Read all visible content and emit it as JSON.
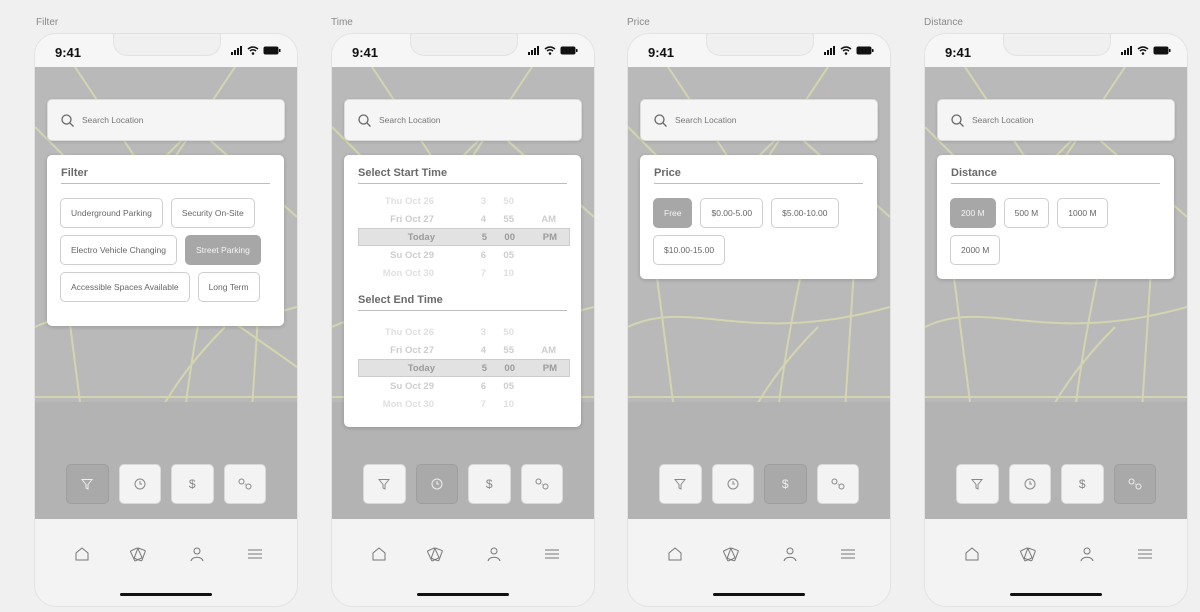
{
  "status": {
    "time": "9:41"
  },
  "search": {
    "placeholder": "Search Location"
  },
  "frames": [
    {
      "title": "Filter",
      "active_dock": "filter"
    },
    {
      "title": "Time",
      "active_dock": "time"
    },
    {
      "title": "Price",
      "active_dock": "price"
    },
    {
      "title": "Distance",
      "active_dock": "distance"
    }
  ],
  "filter_panel": {
    "title": "Filter",
    "options": [
      "Underground Parking",
      "Security On-Site",
      "Electro Vehicle Changing",
      "Street Parking",
      "Accessible Spaces Available",
      "Long Term"
    ],
    "selected": "Street Parking"
  },
  "time_panel": {
    "start_title": "Select Start Time",
    "end_title": "Select End Time",
    "rows": [
      {
        "day": "Thu Oct 26",
        "hour": "3",
        "minute": "50",
        "ampm": ""
      },
      {
        "day": "Fri Oct 27",
        "hour": "4",
        "minute": "55",
        "ampm": "AM"
      },
      {
        "day": "Today",
        "hour": "5",
        "minute": "00",
        "ampm": "PM"
      },
      {
        "day": "Su Oct 29",
        "hour": "6",
        "minute": "05",
        "ampm": ""
      },
      {
        "day": "Mon Oct 30",
        "hour": "7",
        "minute": "10",
        "ampm": ""
      }
    ]
  },
  "price_panel": {
    "title": "Price",
    "options": [
      "Free",
      "$0.00-5.00",
      "$5.00-10.00",
      "$10.00-15.00"
    ],
    "selected": "Free"
  },
  "distance_panel": {
    "title": "Distance",
    "options": [
      "200 M",
      "500 M",
      "1000 M",
      "2000 M"
    ],
    "selected": "200 M"
  },
  "dock": {
    "items": [
      "filter-icon",
      "clock-icon",
      "dollar-icon",
      "distance-icon"
    ],
    "dollar_glyph": "$"
  },
  "tabbar": {
    "items": [
      "home-icon",
      "tickets-icon",
      "profile-icon",
      "menu-icon"
    ]
  },
  "colors": {
    "map": "#b9b9b9",
    "road": "#d8d8b4",
    "selected": "#a7a7a7"
  }
}
